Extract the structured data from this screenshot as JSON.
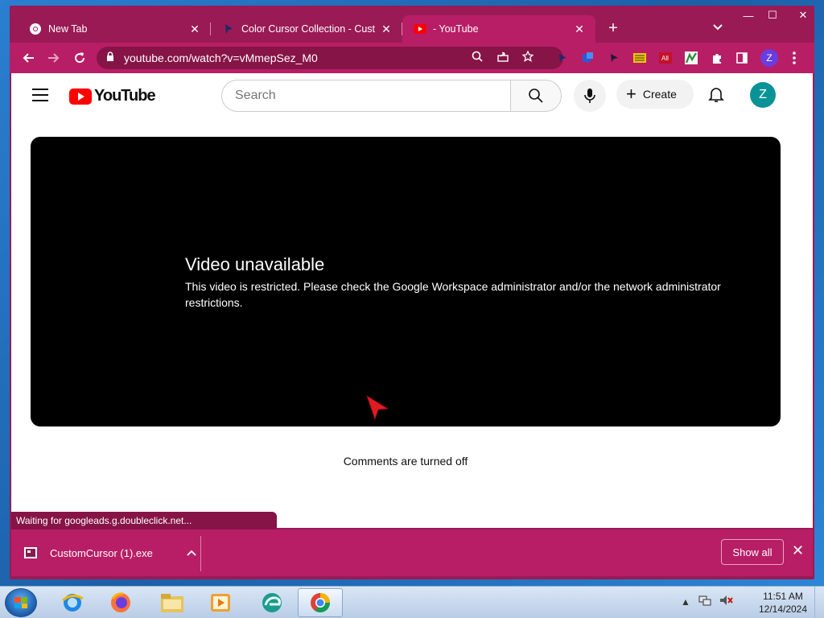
{
  "browser": {
    "tabs": [
      {
        "title": "New Tab",
        "icon": "chrome-icon",
        "active": false
      },
      {
        "title": "Color Cursor Collection - Custom",
        "icon": "cursor-icon",
        "active": false
      },
      {
        "title": "- YouTube",
        "icon": "youtube-icon",
        "active": true
      }
    ],
    "new_tab_symbol": "+",
    "tab_search_symbol": "⌄",
    "window_controls": {
      "minimize": "—",
      "maximize": "☐",
      "close": "✕"
    },
    "url": "youtube.com/watch?v=vMmepSez_M0",
    "profile_initial": "Z",
    "status_text": "Waiting for googleads.g.doubleclick.net...",
    "theme_color": "#b81e65"
  },
  "youtube": {
    "logo_text": "YouTube",
    "search_placeholder": "Search",
    "create_label": "Create",
    "avatar_initial": "Z",
    "error_title": "Video unavailable",
    "error_message": "This video is restricted. Please check the Google Workspace administrator and/or the network administrator restrictions.",
    "comments_status": "Comments are turned off"
  },
  "downloads": {
    "file_name": "CustomCursor (1).exe",
    "show_all_label": "Show all"
  },
  "taskbar": {
    "apps": [
      "internet-explorer",
      "firefox",
      "file-explorer",
      "media-player",
      "edge",
      "chrome"
    ],
    "active_app": "chrome",
    "time": "11:51 AM",
    "date": "12/14/2024"
  }
}
